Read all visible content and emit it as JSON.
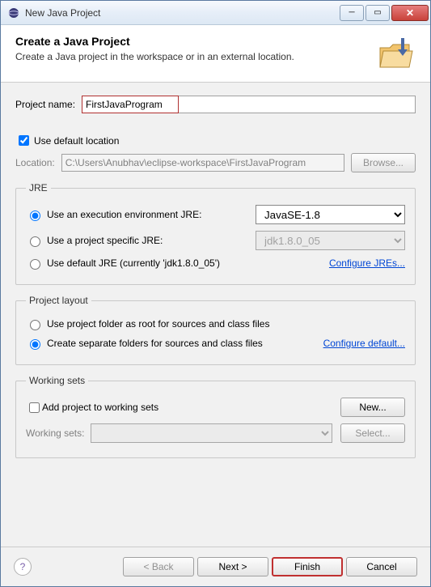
{
  "window": {
    "title": "New Java Project"
  },
  "header": {
    "title": "Create a Java Project",
    "subtitle": "Create a Java project in the workspace or in an external location."
  },
  "project": {
    "name_label": "Project name:",
    "name_value": "FirstJavaProgram",
    "use_default_location_label": "Use default location",
    "use_default_location_checked": true,
    "location_label": "Location:",
    "location_value": "C:\\Users\\Anubhav\\eclipse-workspace\\FirstJavaProgram",
    "browse_label": "Browse..."
  },
  "jre": {
    "legend": "JRE",
    "exec_env_label": "Use an execution environment JRE:",
    "exec_env_value": "JavaSE-1.8",
    "project_specific_label": "Use a project specific JRE:",
    "project_specific_value": "jdk1.8.0_05",
    "default_label": "Use default JRE (currently 'jdk1.8.0_05')",
    "configure_link": "Configure JREs..."
  },
  "layout": {
    "legend": "Project layout",
    "root_label": "Use project folder as root for sources and class files",
    "separate_label": "Create separate folders for sources and class files",
    "configure_link": "Configure default..."
  },
  "working_sets": {
    "legend": "Working sets",
    "add_label": "Add project to working sets",
    "new_label": "New...",
    "list_label": "Working sets:",
    "select_label": "Select..."
  },
  "buttons": {
    "back": "< Back",
    "next": "Next >",
    "finish": "Finish",
    "cancel": "Cancel"
  }
}
